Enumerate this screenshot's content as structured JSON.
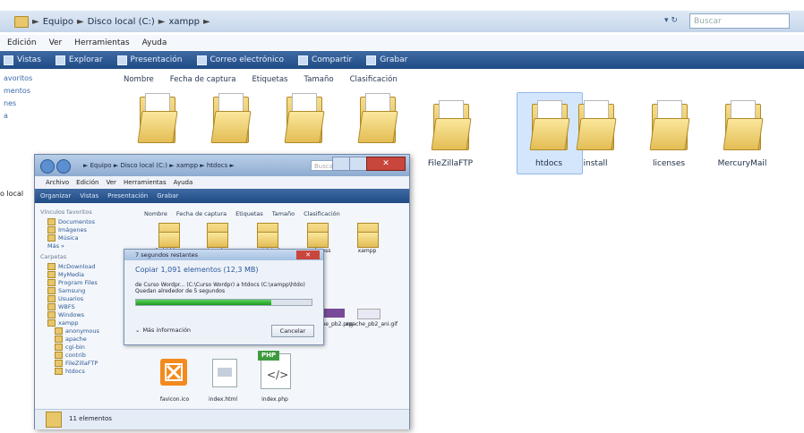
{
  "back_window": {
    "breadcrumb": [
      "Equipo",
      "Disco local (C:)",
      "xampp"
    ],
    "search_placeholder": "Buscar",
    "menu": [
      "Edición",
      "Ver",
      "Herramientas",
      "Ayuda"
    ],
    "toolbar": [
      "Vistas",
      "Explorar",
      "Presentación",
      "Correo electrónico",
      "Compartir",
      "Grabar"
    ],
    "nav_items": [
      "avoritos",
      "mentos",
      "nes",
      "a",
      "",
      "",
      "o local"
    ],
    "columns": [
      "Nombre",
      "Fecha de captura",
      "Etiquetas",
      "Tamaño",
      "Clasificación"
    ],
    "folders": [
      "",
      "",
      "",
      "",
      "FileZillaFTP",
      "htdocs",
      "install",
      "licenses",
      "MercuryMail"
    ],
    "selected_folder": "htdocs"
  },
  "front_window": {
    "breadcrumb": [
      "Equipo",
      "Disco local (C:)",
      "xampp",
      "htdocs"
    ],
    "search_placeholder": "Buscar",
    "menu": [
      "Archivo",
      "Edición",
      "Ver",
      "Herramientas",
      "Ayuda"
    ],
    "toolbar": [
      "Organizar",
      "Vistas",
      "Presentación",
      "Grabar"
    ],
    "nav_header_fav": "Vínculos favoritos",
    "nav_fav": [
      "Documentos",
      "Imágenes",
      "Música",
      "Más »"
    ],
    "nav_header_folders": "Carpetas",
    "nav_folders": [
      "McDownload",
      "MyMedia",
      "Program Files",
      "Samsung",
      "Usuarios",
      "WBFS",
      "Windows",
      "xampp",
      "anonymous",
      "apache",
      "cgi-bin",
      "contrib",
      "FileZillaFTP",
      "htdocs"
    ],
    "columns": [
      "Nombre",
      "Fecha de captura",
      "Etiquetas",
      "Tamaño",
      "Clasificación"
    ],
    "top_folders": [
      "forbidden",
      "joomla",
      "restricted",
      "wordpress",
      "xampp"
    ],
    "files": [
      {
        "name": "favicon.ico",
        "icon": "xampp-icon"
      },
      {
        "name": "index.html",
        "icon": "html-file-icon"
      },
      {
        "name": "index.php",
        "icon": "php-file-icon"
      }
    ],
    "right_files": [
      "apache_pb2.png",
      "apache_pb2_ani.gif"
    ],
    "status": "11 elementos"
  },
  "copy_dialog": {
    "title": "7 segundos restantes",
    "heading": "Copiar 1,091 elementos (12,3 MB)",
    "from_line": "de Curso Wordpr... (C:\\Curso Wordpr) a htdocs (C:\\xampp\\htdo)",
    "remaining": "Quedan alrededor de 5 segundos",
    "progress": 0.77,
    "more_info": "Más información",
    "cancel": "Cancelar"
  }
}
